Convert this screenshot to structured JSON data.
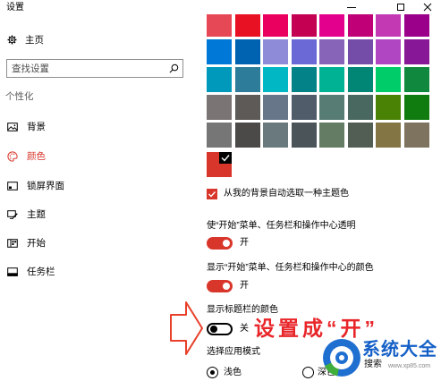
{
  "window": {
    "title": "设置",
    "controls": {
      "minimize": "minimize-icon",
      "maximize": "maximize-icon",
      "close": "close-icon"
    }
  },
  "sidebar": {
    "home": {
      "label": "主页",
      "icon": "gear-icon"
    },
    "search": {
      "placeholder": "查找设置",
      "value": "",
      "icon": "search-icon"
    },
    "section_title": "个性化",
    "selected_index": 1,
    "items": [
      {
        "label": "背景",
        "icon": "picture-icon"
      },
      {
        "label": "颜色",
        "icon": "palette-icon"
      },
      {
        "label": "锁屏界面",
        "icon": "lock-screen-icon"
      },
      {
        "label": "主题",
        "icon": "theme-icon"
      },
      {
        "label": "开始",
        "icon": "start-icon"
      },
      {
        "label": "任务栏",
        "icon": "taskbar-icon"
      }
    ]
  },
  "colors": {
    "accent": "#D9362B",
    "selected_custom": "#D9362B",
    "palette": [
      [
        "#E74856",
        "#E81123",
        "#EA005E",
        "#C30052",
        "#E3008C",
        "#BF0077",
        "#C239B3",
        "#9A0089"
      ],
      [
        "#0078D7",
        "#0063B1",
        "#8E8CD8",
        "#6B69D6",
        "#8764B8",
        "#744DA9",
        "#B146C2",
        "#881798"
      ],
      [
        "#0099BC",
        "#2D7D9A",
        "#00B7C3",
        "#038387",
        "#00B294",
        "#018574",
        "#00CC6A",
        "#10893E"
      ],
      [
        "#7A7574",
        "#5D5A58",
        "#68768A",
        "#515C6B",
        "#567C73",
        "#486860",
        "#498205",
        "#107C10"
      ],
      [
        "#767676",
        "#4C4A48",
        "#69797E",
        "#4A5459",
        "#647C64",
        "#525E54",
        "#847545",
        "#7E735F"
      ]
    ]
  },
  "settings": {
    "auto_pick": {
      "label": "从我的背景自动选取一种主题色",
      "checked": true
    },
    "transparency": {
      "label": "使“开始”菜单、任务栏和操作中心透明",
      "state": "开",
      "on": true
    },
    "show_color_start": {
      "label": "显示“开始”菜单、任务栏和操作中心的颜色",
      "state": "开",
      "on": true
    },
    "show_color_titlebar": {
      "label": "显示标题栏的颜色",
      "state": "关",
      "on": false
    },
    "app_mode": {
      "label": "选择应用模式",
      "options": [
        "浅色",
        "深色"
      ],
      "selected_index": 0
    }
  },
  "annotation": {
    "text": "设置成“开”",
    "color": "#E8262A"
  },
  "watermark": {
    "brand": "系统大全",
    "search": "搜索",
    "url": "www.xp85.com",
    "brand_color": "#1560C7"
  }
}
